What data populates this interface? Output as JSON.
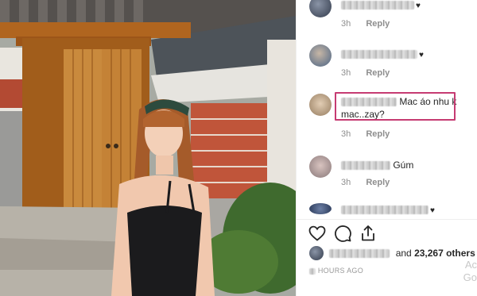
{
  "photo": {
    "icon": "photo-image"
  },
  "comments": [
    {
      "text": "",
      "heart": "♥",
      "time": "3h",
      "reply": "Reply"
    },
    {
      "text": "",
      "heart": "♥",
      "time": "3h",
      "reply": "Reply"
    },
    {
      "text": "Mac áo nhu k mac..zay?",
      "line1": "Mac áo nhu k",
      "line2": "mac..zay?",
      "heart": "",
      "time": "3h",
      "reply": "Reply"
    },
    {
      "text": "Gúm",
      "heart": "",
      "time": "3h",
      "reply": "Reply"
    },
    {
      "text": "",
      "heart": "♥",
      "time": "",
      "reply": ""
    }
  ],
  "actions": {
    "like_icon": "heart-outline-icon",
    "comment_icon": "comment-bubble-icon",
    "share_icon": "share-upload-icon"
  },
  "likes": {
    "and_text": "and",
    "count_text": "23,267 others"
  },
  "posted": {
    "text": "HOURS AGO"
  },
  "watermark": {
    "top": "Ac",
    "bottom": "Go"
  },
  "colors": {
    "highlight": "#c63b72",
    "text": "#262626",
    "muted": "#8e8e8e"
  }
}
